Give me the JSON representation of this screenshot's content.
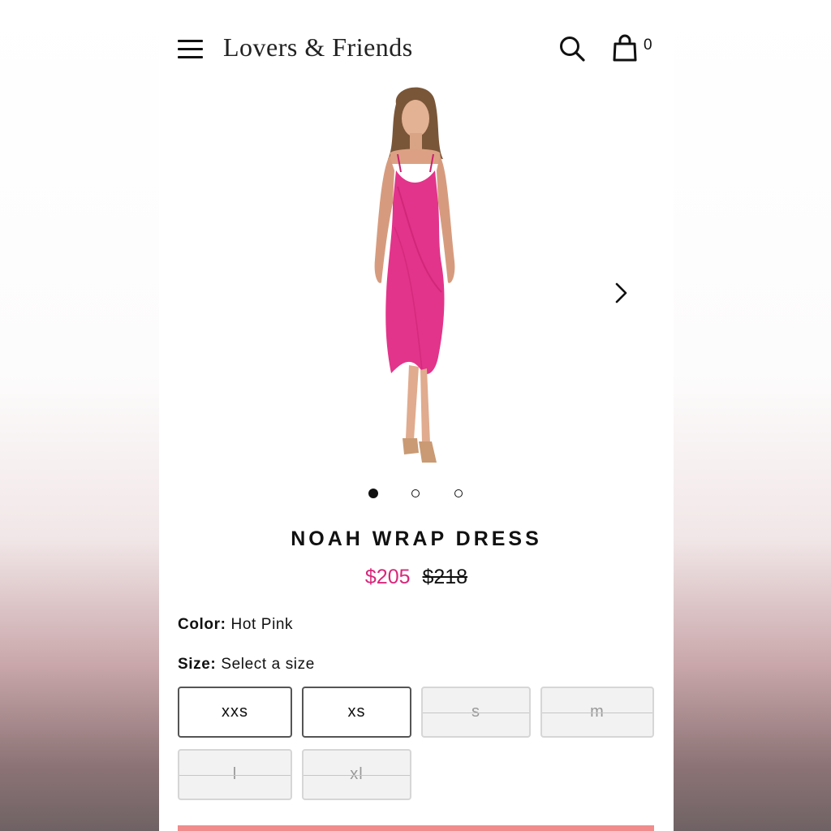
{
  "header": {
    "brand": "Lovers & Friends",
    "cart_count": "0",
    "menu_icon": "hamburger-menu-icon",
    "search_icon": "search-icon",
    "bag_icon": "shopping-bag-icon"
  },
  "gallery": {
    "image_alt": "Model wearing hot pink wrap dress",
    "next_icon": "chevron-right-icon",
    "dots_total": 3,
    "active_index": 0
  },
  "product": {
    "name": "NOAH WRAP DRESS",
    "sale_price": "$205",
    "original_price": "$218",
    "color_label": "Color:",
    "color_value": "Hot Pink",
    "size_label": "Size:",
    "size_value": "Select a size",
    "sizes": [
      {
        "label": "xxs",
        "available": true
      },
      {
        "label": "xs",
        "available": true
      },
      {
        "label": "s",
        "available": false
      },
      {
        "label": "m",
        "available": false
      },
      {
        "label": "l",
        "available": false
      },
      {
        "label": "xl",
        "available": false
      }
    ]
  },
  "colors": {
    "sale_price": "#d9267a",
    "dress": "#e2348a",
    "add_to_bag_bar": "#f08c8c"
  }
}
